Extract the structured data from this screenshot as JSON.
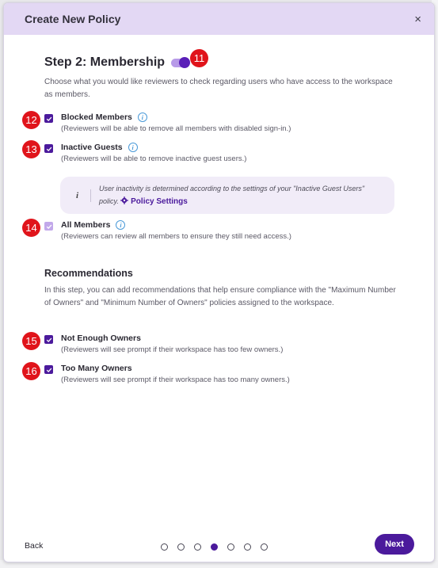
{
  "dialog": {
    "title": "Create New Policy",
    "close_glyph": "×"
  },
  "step": {
    "title": "Step 2: Membership",
    "toggle_on": true,
    "description": "Choose what you would like reviewers to check regarding users who have access to the workspace as members."
  },
  "membership_items": [
    {
      "label": "Blocked Members",
      "sub": "(Reviewers will be able to remove all members with disabled sign-in.)",
      "checked": true,
      "has_info": true,
      "badge": "12"
    },
    {
      "label": "Inactive Guests",
      "sub": "(Reviewers will be able to remove inactive guest users.)",
      "checked": true,
      "has_info": true,
      "badge": "13"
    },
    {
      "label": "All Members",
      "sub": "(Reviewers can review all members to ensure they still need access.)",
      "checked": true,
      "disabled": true,
      "has_info": true,
      "badge": "14"
    }
  ],
  "note": {
    "icon_glyph": "i",
    "text": "User inactivity is determined according to the settings of your \"Inactive Guest Users\" policy.",
    "link_label": "Policy Settings",
    "link_icon": "gear-icon"
  },
  "recommendations": {
    "title": "Recommendations",
    "description": "In this step, you can add recommendations that help ensure compliance with the \"Maximum Number of Owners\" and \"Minimum Number of Owners\" policies assigned to the workspace.",
    "items": [
      {
        "label": "Not Enough Owners",
        "sub": "(Reviewers will see prompt if their workspace has too few owners.)",
        "checked": true,
        "badge": "15"
      },
      {
        "label": "Too Many Owners",
        "sub": "(Reviewers will see prompt if their workspace has too many owners.)",
        "checked": true,
        "badge": "16"
      }
    ]
  },
  "toggle_badge": "11",
  "footer": {
    "back_label": "Back",
    "next_label": "Next",
    "total_steps": 7,
    "current_step": 4
  },
  "colors": {
    "accent": "#4b1a9c",
    "header_bg": "#e3d8f4",
    "badge": "#e0141b"
  }
}
